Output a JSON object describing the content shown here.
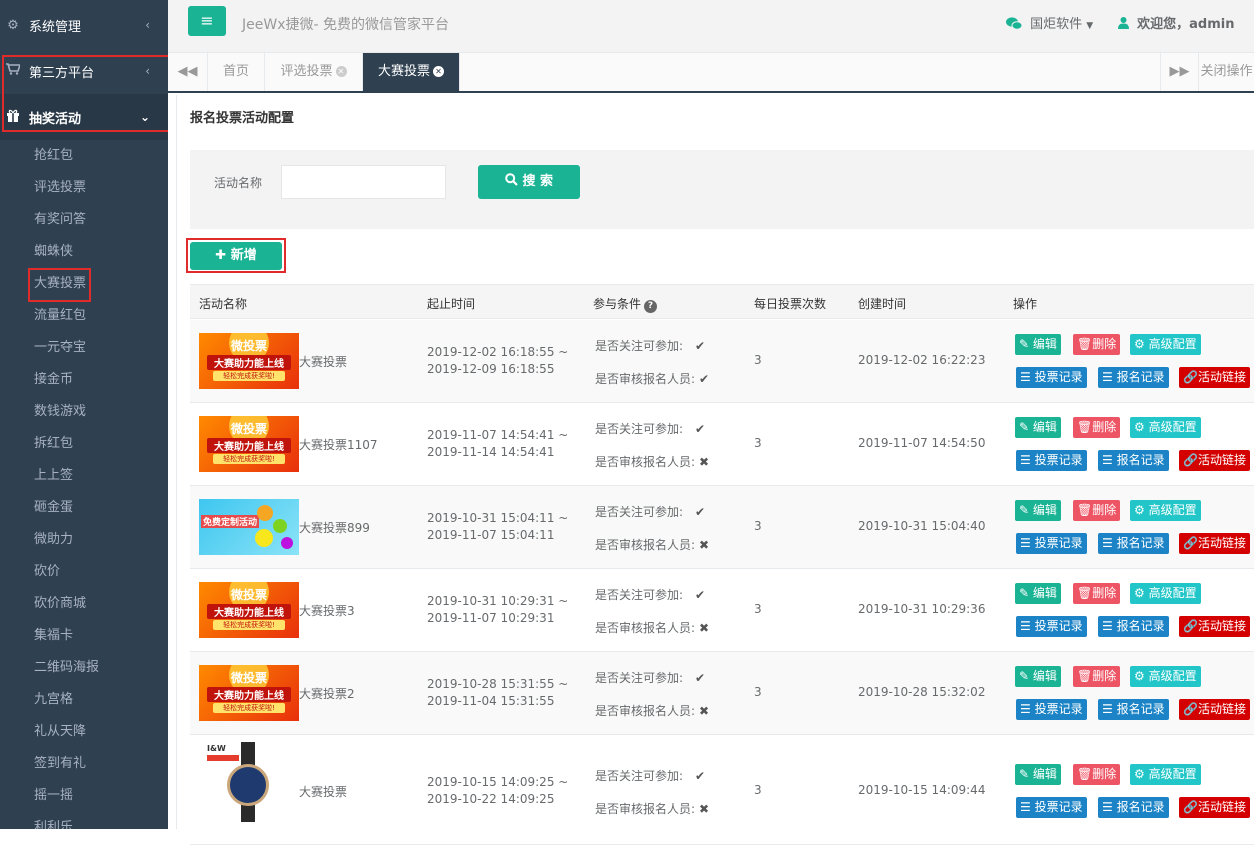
{
  "sidebar": {
    "sections": [
      {
        "label": "系统管理",
        "icon": "gear-icon",
        "arrow": "‹"
      },
      {
        "label": "第三方平台",
        "icon": "cart-icon",
        "arrow": "‹"
      },
      {
        "label": "抽奖活动",
        "icon": "gift-icon",
        "arrow": "⌄"
      }
    ],
    "items": [
      "抢红包",
      "评选投票",
      "有奖问答",
      "蜘蛛侠",
      "大赛投票",
      "流量红包",
      "一元夺宝",
      "接金币",
      "数钱游戏",
      "拆红包",
      "上上签",
      "砸金蛋",
      "微助力",
      "砍价",
      "砍价商城",
      "集福卡",
      "二维码海报",
      "九宫格",
      "礼从天降",
      "签到有礼",
      "摇一摇",
      "利利乐"
    ]
  },
  "header": {
    "brand": "JeeWx捷微- 免费的微信管家平台",
    "company": "国炬软件",
    "welcome": "欢迎您，admin"
  },
  "tabs": {
    "items": [
      "首页",
      "评选投票",
      "大赛投票"
    ],
    "close_ops": "关闭操作"
  },
  "page": {
    "title": "报名投票活动配置",
    "search_label": "活动名称",
    "search_value": "",
    "search_button": "搜 索",
    "add_button": "新增"
  },
  "table": {
    "headers": [
      "活动名称",
      "起止时间",
      "参与条件",
      "每日投票次数",
      "创建时间",
      "操作"
    ],
    "cond_follow": "是否关注可参加:",
    "cond_review": "是否审核报名人员:",
    "check_yes": "✔",
    "check_no": "✖",
    "actions": {
      "edit": "编辑",
      "delete": "删除",
      "advanced": "高级配置",
      "vote_log": "投票记录",
      "signup_log": "报名记录",
      "link": "活动链接"
    },
    "rows": [
      {
        "name": "大赛投票",
        "start": "2019-12-02 16:18:55 ~",
        "end": "2019-12-09 16:18:55",
        "follow": "✔",
        "review": "✔",
        "daily": "3",
        "created": "2019-12-02 16:22:23",
        "thumb": "banner-orange"
      },
      {
        "name": "大赛投票1107",
        "start": "2019-11-07 14:54:41 ~",
        "end": "2019-11-14 14:54:41",
        "follow": "✔",
        "review": "✖",
        "daily": "3",
        "created": "2019-11-07 14:54:50",
        "thumb": "banner-orange"
      },
      {
        "name": "大赛投票899",
        "start": "2019-10-31 15:04:11 ~",
        "end": "2019-11-07 15:04:11",
        "follow": "✔",
        "review": "✖",
        "daily": "3",
        "created": "2019-10-31 15:04:40",
        "thumb": "banner-blue"
      },
      {
        "name": "大赛投票3",
        "start": "2019-10-31 10:29:31 ~",
        "end": "2019-11-07 10:29:31",
        "follow": "✔",
        "review": "✖",
        "daily": "3",
        "created": "2019-10-31 10:29:36",
        "thumb": "banner-orange"
      },
      {
        "name": "大赛投票2",
        "start": "2019-10-28 15:31:55 ~",
        "end": "2019-11-04 15:31:55",
        "follow": "✔",
        "review": "✖",
        "daily": "3",
        "created": "2019-10-28 15:32:02",
        "thumb": "banner-orange"
      },
      {
        "name": "大赛投票",
        "start": "2019-10-15 14:09:25 ~",
        "end": "2019-10-22 14:09:25",
        "follow": "✔",
        "review": "✖",
        "daily": "3",
        "created": "2019-10-15 14:09:44",
        "thumb": "watch"
      }
    ]
  },
  "banner_text": {
    "line1": "微投票",
    "line2": "大赛助力能上线",
    "line3": "轻松完成获奖啦!",
    "blue": "免费定制活动",
    "watch_brand": "I&W"
  },
  "colors": {
    "sidebar": "#2f4050",
    "primary": "#1ab394",
    "tab_active": "#2f4050",
    "highlight": "#e02b2b"
  }
}
